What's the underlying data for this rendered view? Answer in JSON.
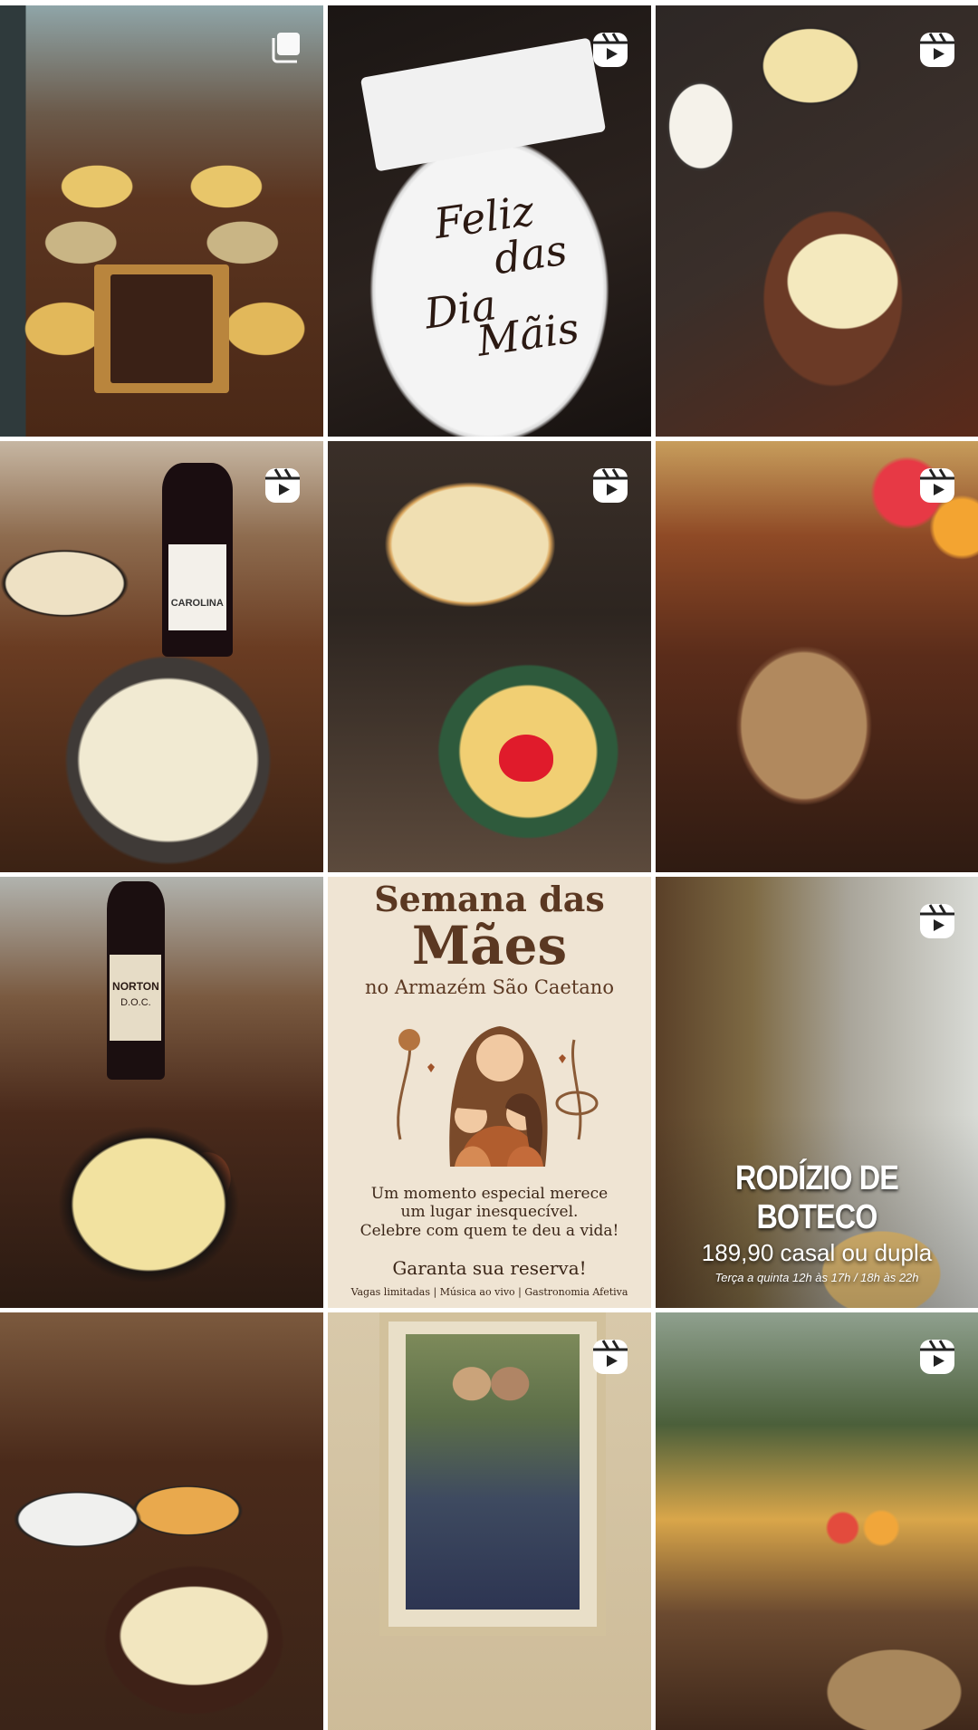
{
  "grid": {
    "tiles": [
      {
        "id": 1,
        "type": "carousel",
        "alt_icon": "multiple-photos-icon"
      },
      {
        "id": 2,
        "type": "reel",
        "alt_icon": "reels-icon",
        "plate_text": "Feliz Dia das Mães"
      },
      {
        "id": 3,
        "type": "reel",
        "alt_icon": "reels-icon"
      },
      {
        "id": 4,
        "type": "reel",
        "alt_icon": "reels-icon"
      },
      {
        "id": 5,
        "type": "reel",
        "alt_icon": "reels-icon"
      },
      {
        "id": 6,
        "type": "reel",
        "alt_icon": "reels-icon"
      },
      {
        "id": 7,
        "type": "photo"
      },
      {
        "id": 8,
        "type": "photo"
      },
      {
        "id": 9,
        "type": "reel",
        "alt_icon": "reels-icon"
      },
      {
        "id": 10,
        "type": "photo"
      },
      {
        "id": 11,
        "type": "reel",
        "alt_icon": "reels-icon"
      },
      {
        "id": 12,
        "type": "reel",
        "alt_icon": "reels-icon"
      }
    ]
  },
  "poster": {
    "title_line1": "Semana das",
    "title_line2": "Mães",
    "subtitle": "no Armazém São Caetano",
    "body_line1": "Um momento especial merece",
    "body_line2": "um lugar inesquecível.",
    "body_line3": "Celebre com quem te deu a vida!",
    "cta": "Garanta sua reserva!",
    "footer": "Vagas limitadas | Música ao vivo | Gastronomia Afetiva"
  },
  "tile2": {
    "plate_line1": "Feliz",
    "plate_line2": "das",
    "plate_line3": "Dia",
    "plate_line4": "Mãis"
  },
  "wine_labels": {
    "tile4": "CAROLINA",
    "tile7_line1": "NORTON",
    "tile7_line2": "D.O.C."
  },
  "promo": {
    "title": "RODÍZIO DE BOTECO",
    "price": "189,90 casal ou dupla",
    "schedule": "Terça a quinta 12h às 17h / 18h às 22h"
  },
  "colors": {
    "background": "#ffffff",
    "poster_bg": "#efe4d3",
    "poster_text": "#5b3822"
  }
}
